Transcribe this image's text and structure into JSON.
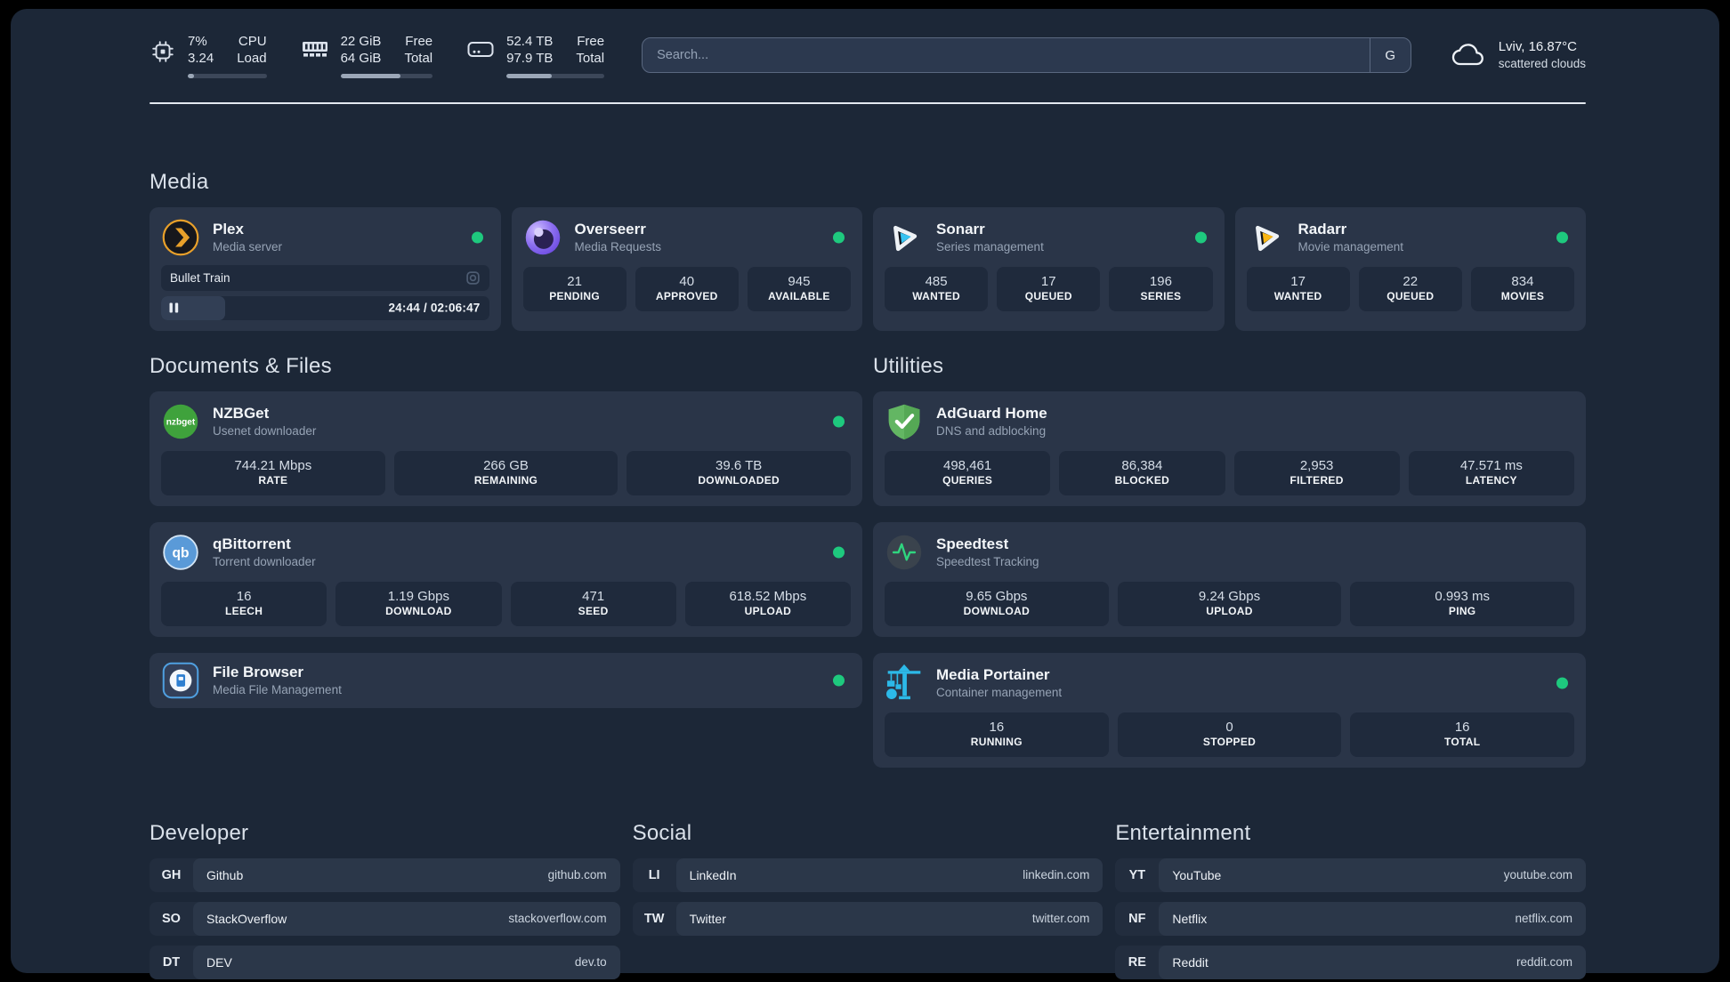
{
  "header": {
    "system": {
      "cpu": {
        "value_top": "7%",
        "value_bottom": "3.24",
        "label_top": "CPU",
        "label_bottom": "Load",
        "bar_style": "width:8%"
      },
      "memory": {
        "value_top": "22 GiB",
        "value_bottom": "64 GiB",
        "label_top": "Free",
        "label_bottom": "Total",
        "bar_style": "width:65%"
      },
      "disk": {
        "value_top": "52.4 TB",
        "value_bottom": "97.9 TB",
        "label_top": "Free",
        "label_bottom": "Total",
        "bar_style": "width:46%"
      }
    },
    "search": {
      "placeholder": "Search...",
      "button_label": "G"
    },
    "weather": {
      "location": "Lviv, 16.87°C",
      "condition": "scattered clouds"
    }
  },
  "colors": {
    "status_online_green": "#1ec97e",
    "plex_orange": "#e8a02a",
    "overseerr_purple": "#8b6ef0",
    "sonarr_blue": "#36c3f2",
    "radarr_yellow": "#f9b613",
    "nzbget_green": "#3fa23c",
    "qbittorrent_blue": "#5a9ad8",
    "filebrowser_blue": "#4f9fe0",
    "adguard_green": "#63b663",
    "speedtest_green": "#2fd57f",
    "portainer_cyan": "#2cb9e8"
  },
  "sections": {
    "media": {
      "title": "Media",
      "plex": {
        "name": "Plex",
        "description": "Media server",
        "online": true,
        "now_playing": {
          "title": "Bullet Train",
          "time_display": "24:44 / 02:06:47",
          "bar_style": "width:19.5%"
        }
      },
      "cards": [
        {
          "name": "Overseerr",
          "description": "Media Requests",
          "online": true,
          "stats": [
            {
              "value": "21",
              "label": "PENDING"
            },
            {
              "value": "40",
              "label": "APPROVED"
            },
            {
              "value": "945",
              "label": "AVAILABLE"
            }
          ]
        },
        {
          "name": "Sonarr",
          "description": "Series management",
          "online": true,
          "stats": [
            {
              "value": "485",
              "label": "WANTED"
            },
            {
              "value": "17",
              "label": "QUEUED"
            },
            {
              "value": "196",
              "label": "SERIES"
            }
          ]
        },
        {
          "name": "Radarr",
          "description": "Movie management",
          "online": true,
          "stats": [
            {
              "value": "17",
              "label": "WANTED"
            },
            {
              "value": "22",
              "label": "QUEUED"
            },
            {
              "value": "834",
              "label": "MOVIES"
            }
          ]
        }
      ]
    },
    "documents": {
      "title": "Documents & Files",
      "cards": [
        {
          "name": "NZBGet",
          "description": "Usenet downloader",
          "online": true,
          "stats": [
            {
              "value": "744.21 Mbps",
              "label": "RATE"
            },
            {
              "value": "266 GB",
              "label": "REMAINING"
            },
            {
              "value": "39.6 TB",
              "label": "DOWNLOADED"
            }
          ]
        },
        {
          "name": "qBittorrent",
          "description": "Torrent downloader",
          "online": true,
          "stats": [
            {
              "value": "16",
              "label": "LEECH"
            },
            {
              "value": "1.19 Gbps",
              "label": "DOWNLOAD"
            },
            {
              "value": "471",
              "label": "SEED"
            },
            {
              "value": "618.52 Mbps",
              "label": "UPLOAD"
            }
          ]
        },
        {
          "name": "File Browser",
          "description": "Media File Management",
          "online": true,
          "stats": []
        }
      ]
    },
    "utilities": {
      "title": "Utilities",
      "cards": [
        {
          "name": "AdGuard Home",
          "description": "DNS and adblocking",
          "online": false,
          "stats": [
            {
              "value": "498,461",
              "label": "QUERIES"
            },
            {
              "value": "86,384",
              "label": "BLOCKED"
            },
            {
              "value": "2,953",
              "label": "FILTERED"
            },
            {
              "value": "47.571 ms",
              "label": "LATENCY"
            }
          ]
        },
        {
          "name": "Speedtest",
          "description": "Speedtest Tracking",
          "online": false,
          "stats": [
            {
              "value": "9.65 Gbps",
              "label": "DOWNLOAD"
            },
            {
              "value": "9.24 Gbps",
              "label": "UPLOAD"
            },
            {
              "value": "0.993 ms",
              "label": "PING"
            }
          ]
        },
        {
          "name": "Media Portainer",
          "description": "Container management",
          "online": true,
          "stats": [
            {
              "value": "16",
              "label": "RUNNING"
            },
            {
              "value": "0",
              "label": "STOPPED"
            },
            {
              "value": "16",
              "label": "TOTAL"
            }
          ]
        }
      ]
    },
    "links": [
      {
        "title": "Developer",
        "items": [
          {
            "abbr": "GH",
            "name": "Github",
            "url": "github.com"
          },
          {
            "abbr": "SO",
            "name": "StackOverflow",
            "url": "stackoverflow.com"
          },
          {
            "abbr": "DT",
            "name": "DEV",
            "url": "dev.to"
          }
        ]
      },
      {
        "title": "Social",
        "items": [
          {
            "abbr": "LI",
            "name": "LinkedIn",
            "url": "linkedin.com"
          },
          {
            "abbr": "TW",
            "name": "Twitter",
            "url": "twitter.com"
          }
        ]
      },
      {
        "title": "Entertainment",
        "items": [
          {
            "abbr": "YT",
            "name": "YouTube",
            "url": "youtube.com"
          },
          {
            "abbr": "NF",
            "name": "Netflix",
            "url": "netflix.com"
          },
          {
            "abbr": "RE",
            "name": "Reddit",
            "url": "reddit.com"
          }
        ]
      }
    ]
  }
}
